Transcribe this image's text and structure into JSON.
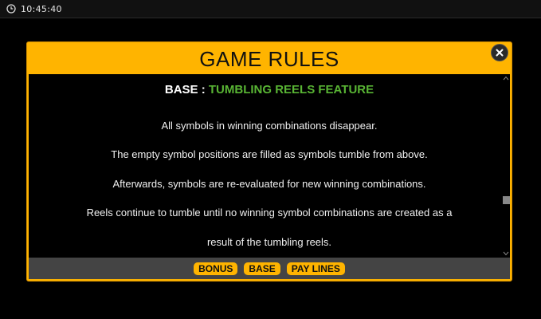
{
  "status_bar": {
    "time": "10:45:40"
  },
  "dialog": {
    "title": "GAME RULES",
    "section": {
      "prefix": "BASE :",
      "title": "TUMBLING REELS FEATURE"
    },
    "lines": [
      "All symbols in winning combinations disappear.",
      "The empty symbol positions are filled as symbols tumble from above.",
      "Afterwards, symbols are re-evaluated for new winning combinations.",
      "Reels continue to tumble until no winning symbol combinations are created as a",
      "result of the tumbling reels."
    ],
    "tabs": [
      "BONUS",
      "BASE",
      "PAY LINES"
    ]
  },
  "colors": {
    "accent": "#ffb400",
    "heading_green": "#59b534",
    "background": "#000000",
    "footer": "#444444"
  },
  "icons": {
    "clock": "clock-icon",
    "close": "close-icon",
    "scroll_up": "chevron-up-icon",
    "scroll_down": "chevron-down-icon"
  }
}
